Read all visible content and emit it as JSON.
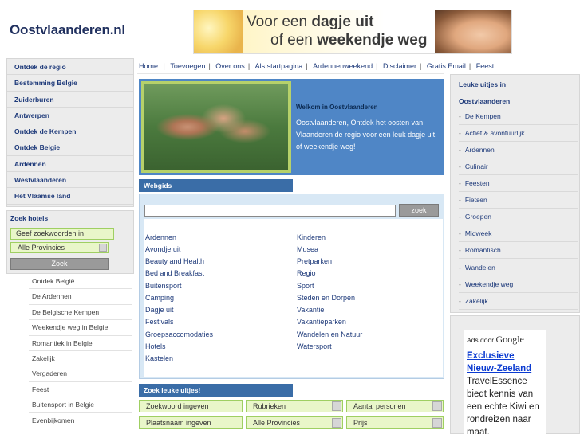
{
  "header": {
    "site_title": "Oostvlaanderen.nl",
    "banner": {
      "line1_normal": "Voor een ",
      "line1_bold": "dagje uit",
      "line2_normal": "of een ",
      "line2_bold": "weekendje weg"
    }
  },
  "left_nav": [
    "Ontdek de regio",
    "Bestemming Belgie",
    "Zuiderburen",
    "Antwerpen",
    "Ontdek de Kempen",
    "Ontdek Belgie",
    "Ardennen",
    "Westvlaanderen",
    "Het Vlaamse land"
  ],
  "hotels": {
    "title": "Zoek hotels",
    "input_value": "Geef zoekwoorden in",
    "select_value": "Alle Provincies",
    "button": "Zoek"
  },
  "sub_nav": [
    "Ontdek België",
    "De Ardennen",
    "De Belgische Kempen",
    "Weekendje weg in Belgie",
    "Romantiek in Belgie",
    "Zakelijk",
    "Vergaderen",
    "Feest",
    "Buitensport in Belgie",
    "Evenbijkomen"
  ],
  "top_nav": [
    "Home",
    "Toevoegen",
    "Over ons",
    "Als startpagina",
    "Ardennenweekend",
    "Disclaimer",
    "Gratis Email",
    "Feest"
  ],
  "welcome": {
    "title": "Welkom in Oostvlaanderen",
    "text": "Oostvlaanderen, Ontdek het oosten van Vlaanderen de regio voor een leuk dagje uit of weekendje weg!"
  },
  "webgids": {
    "tab": "Webgids",
    "search_button": "zoek",
    "col1": [
      "Ardennen",
      "Avondje uit",
      "Beauty and Health",
      "Bed and Breakfast",
      "Buitensport",
      "Camping",
      "Dagje uit",
      "Festivals",
      "Groepsaccomodaties",
      "Hotels",
      "Kastelen"
    ],
    "col2": [
      "Kinderen",
      "Musea",
      "Pretparken",
      "Regio",
      "Sport",
      "Steden en Dorpen",
      "Vakantie",
      "Vakantieparken",
      "Wandelen en Natuur",
      "Watersport"
    ]
  },
  "leuke": {
    "tab": "Zoek leuke uitjes!",
    "keyword": "Zoekwoord ingeven",
    "rubrieken": "Rubrieken",
    "aantal": "Aantal personen",
    "plaatsnaam": "Plaatsnaam ingeven",
    "provincies": "Alle Provincies",
    "prijs": "Prijs"
  },
  "right_nav": {
    "title1": "Leuke uitjes in",
    "title2": "Oostvlaanderen",
    "items": [
      "De Kempen",
      "Actief & avontuurlijk",
      "Ardennen",
      "Culinair",
      "Feesten",
      "Fietsen",
      "Groepen",
      "Midweek",
      "Romantisch",
      "Wandelen",
      "Weekendje weg",
      "Zakelijk"
    ]
  },
  "ads": {
    "by": "Ads door",
    "google": "Google",
    "title": "Exclusieve Nieuw-Zeeland",
    "text": "TravelEssence biedt kennis van een echte Kiwi en rondreizen naar maat."
  }
}
